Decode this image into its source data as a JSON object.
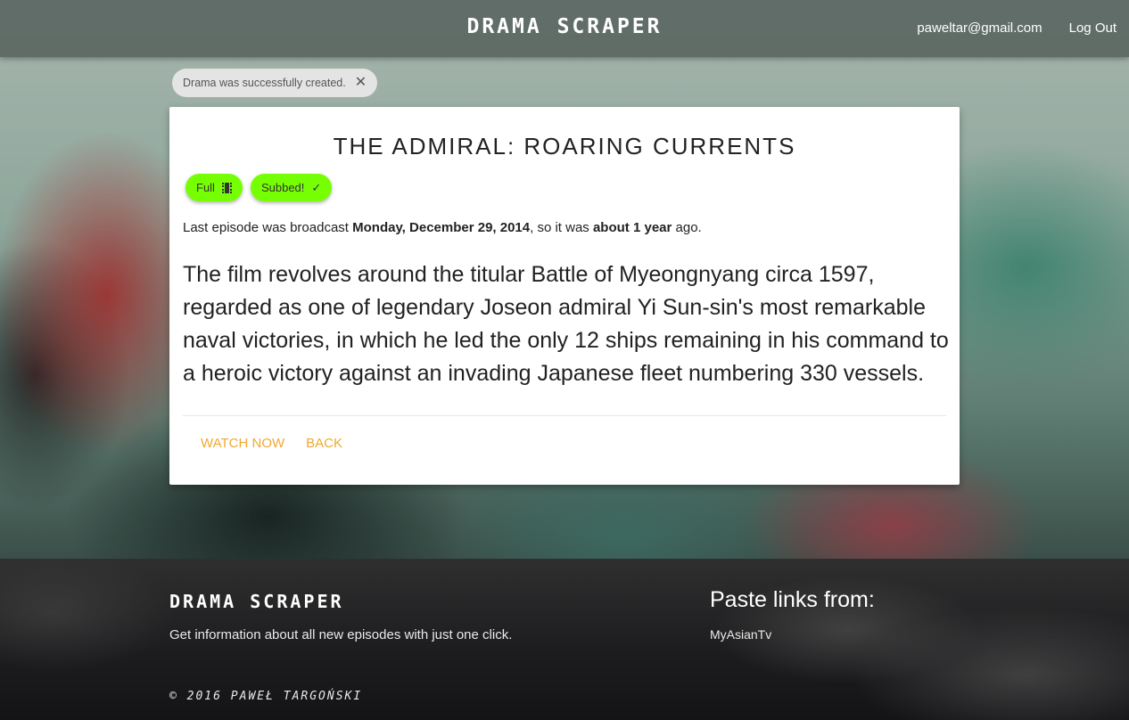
{
  "header": {
    "brand": "DRAMA SCRAPER",
    "user_email": "paweltar@gmail.com",
    "logout": "Log Out"
  },
  "toast": {
    "message": "Drama was successfully created.",
    "close_glyph": "✕"
  },
  "drama": {
    "title": "THE ADMIRAL: ROARING CURRENTS",
    "chips": [
      {
        "label": "Full",
        "icon": "film-icon"
      },
      {
        "label": "Subbed!",
        "icon": "check-icon",
        "glyph": "✓"
      }
    ],
    "chip_color": "#76ff03",
    "last_episode": {
      "prefix": "Last episode was broadcast ",
      "date": "Monday, December 29, 2014",
      "middle": ", so it was ",
      "relative": "about 1 year",
      "suffix": " ago."
    },
    "description": "The film revolves around the titular Battle of Myeongnyang circa 1597, regarded as one of legendary Joseon admiral Yi Sun-sin's most remarkable naval victories, in which he led the only 12 ships remaining in his command to a heroic victory against an invading Japanese fleet numbering 330 vessels.",
    "actions": {
      "watch": "WATCH NOW",
      "back": "BACK"
    },
    "action_color": "#f0a830"
  },
  "footer": {
    "brand": "DRAMA SCRAPER",
    "tagline": "Get information about all new episodes with just one click.",
    "paste_heading": "Paste links from:",
    "sources": [
      "MyAsianTv"
    ],
    "copyright": "© 2016 PAWEŁ TARGOŃSKI"
  }
}
